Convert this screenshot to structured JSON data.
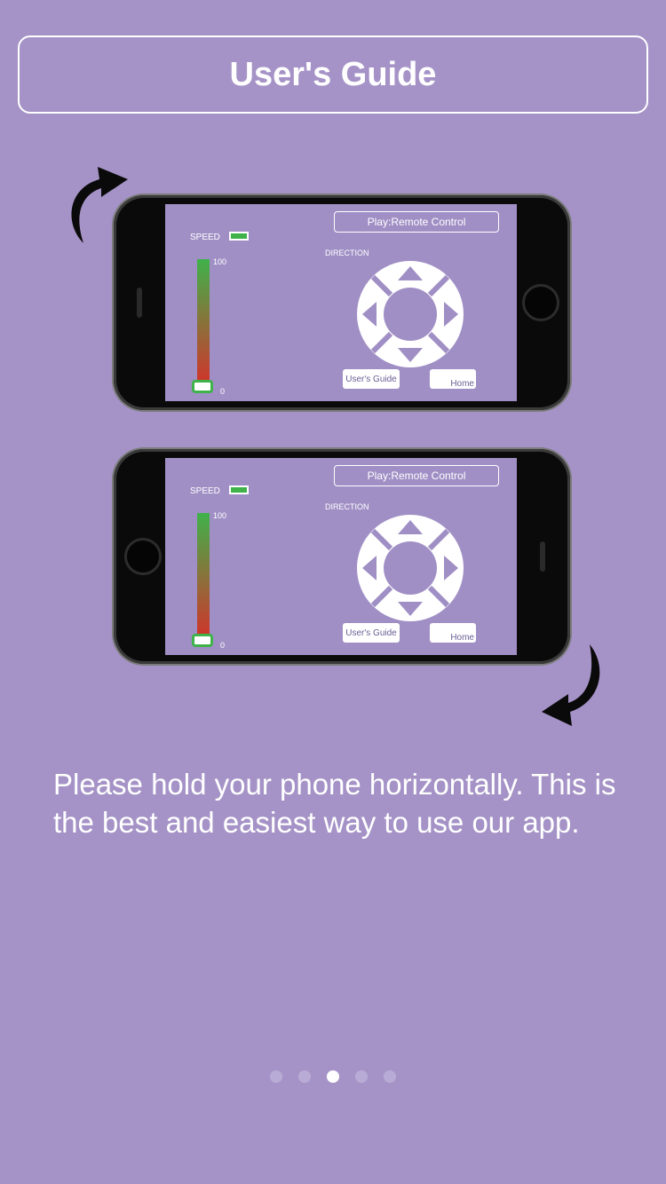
{
  "header": {
    "title": "User's Guide"
  },
  "illustration": {
    "speed_label": "SPEED",
    "tick_top": "100",
    "tick_bottom": "0",
    "mode_button": "Play:Remote Control",
    "direction_label": "DIRECTION",
    "guide_button": "User's Guide",
    "home_button": "Home"
  },
  "instructions": {
    "text": "Please hold your phone horizontally. This is the best and easiest way to use our app."
  },
  "pager": {
    "count": 5,
    "active_index": 2
  },
  "colors": {
    "background": "#a593c7",
    "accent_green": "#3fb24a",
    "accent_red": "#d4312a"
  },
  "icons": [
    "rotate-arrow-icon",
    "dpad-icon",
    "book-icon",
    "home-icon"
  ]
}
